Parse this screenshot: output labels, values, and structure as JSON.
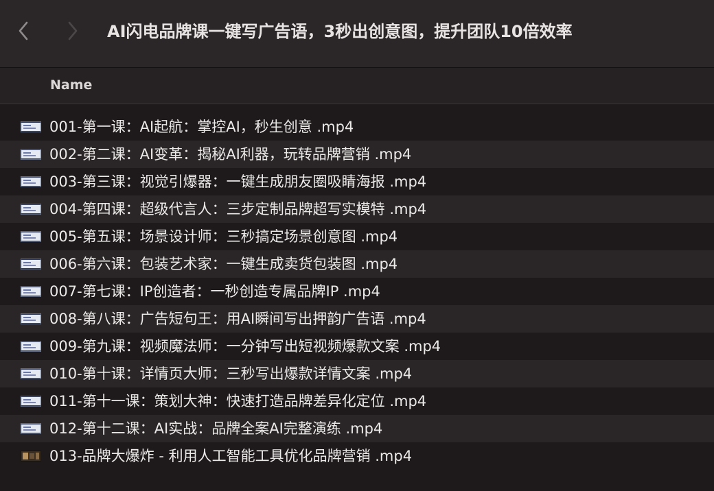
{
  "window": {
    "title": "AI闪电品牌课一键写广告语，3秒出创意图，提升团队10倍效率"
  },
  "toolbar": {
    "back_icon": "chevron-left-icon",
    "forward_icon": "chevron-right-icon"
  },
  "columns": {
    "name": "Name"
  },
  "files": [
    {
      "name": "001-第一课：AI起航：掌控AI，秒生创意 .mp4",
      "icon": "video-thumbnail-icon"
    },
    {
      "name": "002-第二课：AI变革：揭秘AI利器，玩转品牌营销 .mp4",
      "icon": "video-thumbnail-icon"
    },
    {
      "name": "003-第三课：视觉引爆器：一键生成朋友圈吸睛海报 .mp4",
      "icon": "video-thumbnail-icon"
    },
    {
      "name": "004-第四课：超级代言人：三步定制品牌超写实模特 .mp4",
      "icon": "video-thumbnail-icon"
    },
    {
      "name": "005-第五课：场景设计师：三秒搞定场景创意图 .mp4",
      "icon": "video-thumbnail-icon"
    },
    {
      "name": "006-第六课：包装艺术家：一键生成卖货包装图 .mp4",
      "icon": "video-thumbnail-icon"
    },
    {
      "name": "007-第七课：IP创造者：一秒创造专属品牌IP .mp4",
      "icon": "video-thumbnail-icon"
    },
    {
      "name": "008-第八课：广告短句王：用AI瞬间写出押韵广告语 .mp4",
      "icon": "video-thumbnail-icon"
    },
    {
      "name": "009-第九课：视频魔法师：一分钟写出短视频爆款文案 .mp4",
      "icon": "video-thumbnail-icon"
    },
    {
      "name": "010-第十课：详情页大师：三秒写出爆款详情文案 .mp4",
      "icon": "video-thumbnail-icon"
    },
    {
      "name": "011-第十一课：策划大神：快速打造品牌差异化定位 .mp4",
      "icon": "video-thumbnail-icon"
    },
    {
      "name": "012-第十二课：AI实战：品牌全案AI完整演练 .mp4",
      "icon": "video-thumbnail-icon"
    },
    {
      "name": "013-品牌大爆炸 - 利用人工智能工具优化品牌营销 .mp4",
      "icon": "video-thumbnail-dark-icon"
    }
  ],
  "colors": {
    "window_bg": "#1e1a1b",
    "toolbar_bg": "#2b2728",
    "row_alt_bg": "#2a2627",
    "text": "#ece9e9"
  }
}
